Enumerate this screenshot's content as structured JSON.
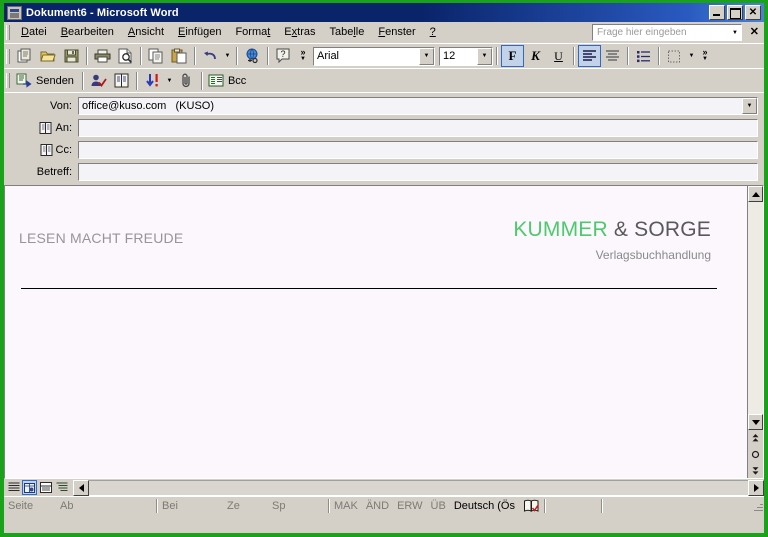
{
  "window": {
    "title": "Dokument6 - Microsoft Word",
    "icon": "word-document-icon",
    "buttons": {
      "minimize": "_",
      "maximize": "□",
      "close": "✕"
    }
  },
  "menubar": {
    "items": [
      {
        "label": "Datei",
        "accel": "D"
      },
      {
        "label": "Bearbeiten",
        "accel": "B"
      },
      {
        "label": "Ansicht",
        "accel": "A"
      },
      {
        "label": "Einfügen",
        "accel": "E"
      },
      {
        "label": "Format",
        "accel": "t"
      },
      {
        "label": "Extras",
        "accel": "x"
      },
      {
        "label": "Tabelle",
        "accel": "l"
      },
      {
        "label": "Fenster",
        "accel": "F"
      },
      {
        "label": "?",
        "accel": "?"
      }
    ],
    "ask_box": {
      "placeholder": "Frage hier eingeben"
    },
    "close_label": "✕"
  },
  "standard_toolbar": {
    "buttons": [
      {
        "name": "new-document-icon",
        "tooltip": "Neu"
      },
      {
        "name": "open-folder-icon",
        "tooltip": "Öffnen"
      },
      {
        "name": "save-disk-icon",
        "tooltip": "Speichern"
      },
      {
        "name": "print-icon",
        "tooltip": "Drucken"
      },
      {
        "name": "print-preview-icon",
        "tooltip": "Seitenansicht"
      },
      {
        "name": "copy-icon",
        "tooltip": "Kopieren"
      },
      {
        "name": "paste-icon",
        "tooltip": "Einfügen"
      },
      {
        "name": "undo-icon",
        "tooltip": "Rückgängig"
      },
      {
        "name": "insert-hyperlink-icon",
        "tooltip": "Hyperlink einfügen"
      },
      {
        "name": "help-icon",
        "tooltip": "Hilfe"
      }
    ],
    "overflow_label": "»"
  },
  "formatting_toolbar": {
    "font_name": "Arial",
    "font_size": "12",
    "bold_label": "F",
    "italic_label": "K",
    "underline_label": "U",
    "align_left": "align-left-icon",
    "align_center": "align-center-icon",
    "bullets": "bullet-list-icon",
    "borders": "borders-icon",
    "overflow_label": "»"
  },
  "mail_toolbar": {
    "send_label": "Senden",
    "check_names_label": "check-names-icon",
    "address_book_label": "address-book-icon",
    "priority_label": "priority-icon",
    "attach_label": "attach-icon",
    "bcc_label": "Bcc"
  },
  "mail_header": {
    "fields": [
      {
        "label": "Von:",
        "value": "office@kuso.com   (KUSO)",
        "has_icon": false,
        "has_dropdown": true
      },
      {
        "label": "An:",
        "value": "",
        "has_icon": true,
        "has_dropdown": false
      },
      {
        "label": "Cc:",
        "value": "",
        "has_icon": true,
        "has_dropdown": false
      },
      {
        "label": "Betreff:",
        "value": "",
        "has_icon": false,
        "has_dropdown": false
      }
    ]
  },
  "document": {
    "slogan": "LESEN MACHT FREUDE",
    "brand_green": "KUMMER",
    "brand_dark": "& SORGE",
    "brand_subtitle": "Verlagsbuchhandlung",
    "colors": {
      "green": "#4ec96e",
      "dark": "#595959",
      "slogan_gray": "#9a939a",
      "page": "#fbf7fd"
    }
  },
  "view_buttons": [
    {
      "name": "normal-view-button",
      "active": false
    },
    {
      "name": "web-layout-view-button",
      "active": true
    },
    {
      "name": "print-layout-view-button",
      "active": false
    },
    {
      "name": "outline-view-button",
      "active": false
    }
  ],
  "statusbar": {
    "cells": [
      {
        "label": "Seite",
        "muted": true
      },
      {
        "label": "Ab",
        "muted": true
      },
      {
        "label": "Bei",
        "muted": true
      },
      {
        "label": "Ze",
        "muted": true
      },
      {
        "label": "Sp",
        "muted": true
      },
      {
        "label": "MAK",
        "muted": true
      },
      {
        "label": "ÄND",
        "muted": true
      },
      {
        "label": "ERW",
        "muted": true
      },
      {
        "label": "ÜB",
        "muted": true
      },
      {
        "label": "Deutsch (Ös",
        "muted": false
      }
    ],
    "spellcheck_icon": "spellcheck-book-icon"
  }
}
